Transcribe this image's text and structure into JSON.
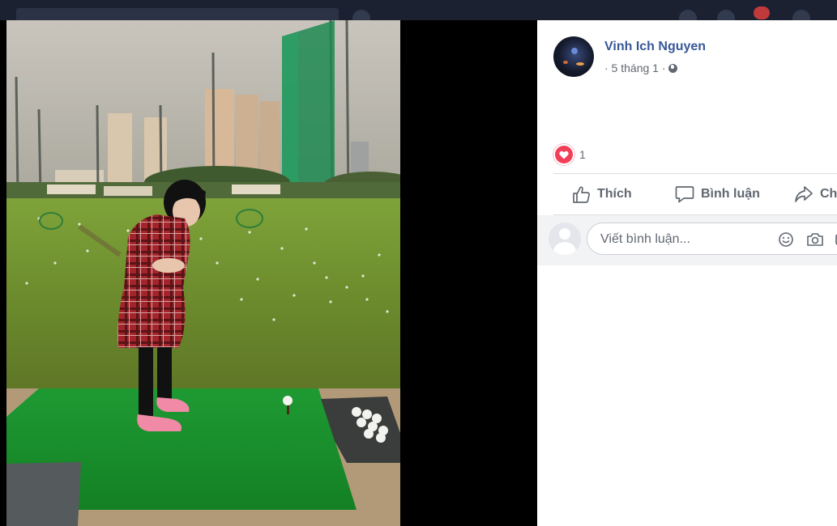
{
  "post": {
    "author": "Vinh Ich Nguyen",
    "timestamp": "· 5 tháng 1 ·",
    "privacy_icon": "globe-icon",
    "reaction_count": "1",
    "reaction_icon": "heart-icon"
  },
  "actions": {
    "like": "Thích",
    "comment": "Bình luận",
    "share": "Ch"
  },
  "comment": {
    "placeholder": "Viết bình luận...",
    "icons": [
      "emoji-icon",
      "camera-icon"
    ]
  },
  "colors": {
    "author_link": "#385898",
    "secondary_text": "#616770",
    "love_red": "#f33e58",
    "panel_bg": "#ffffff",
    "backdrop": "#000000"
  }
}
